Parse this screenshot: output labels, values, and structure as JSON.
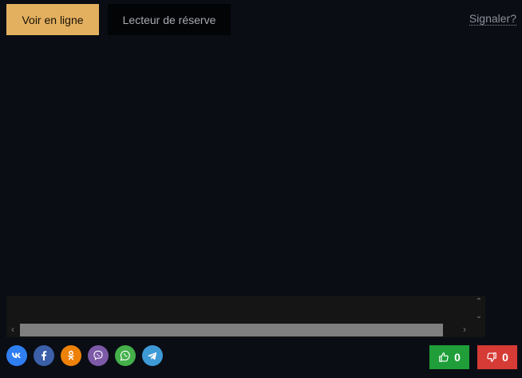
{
  "tabs": [
    {
      "label": "Voir en ligne",
      "active": true
    },
    {
      "label": "Lecteur de réserve",
      "active": false
    }
  ],
  "report_label": "Signaler?",
  "social": [
    {
      "name": "vk",
      "color": "#2f7ff0"
    },
    {
      "name": "facebook",
      "color": "#3b5fa8"
    },
    {
      "name": "odnoklassniki",
      "color": "#ee8208"
    },
    {
      "name": "viber",
      "color": "#7d5aa8"
    },
    {
      "name": "whatsapp",
      "color": "#44b04a"
    },
    {
      "name": "telegram",
      "color": "#3e9ad6"
    }
  ],
  "votes": {
    "like_count": "0",
    "dislike_count": "0",
    "like_color": "#1f9e3a",
    "dislike_color": "#d63b36"
  },
  "scrollbar": {
    "up": "⌃",
    "down": "⌄",
    "left": "‹",
    "right": "›"
  }
}
